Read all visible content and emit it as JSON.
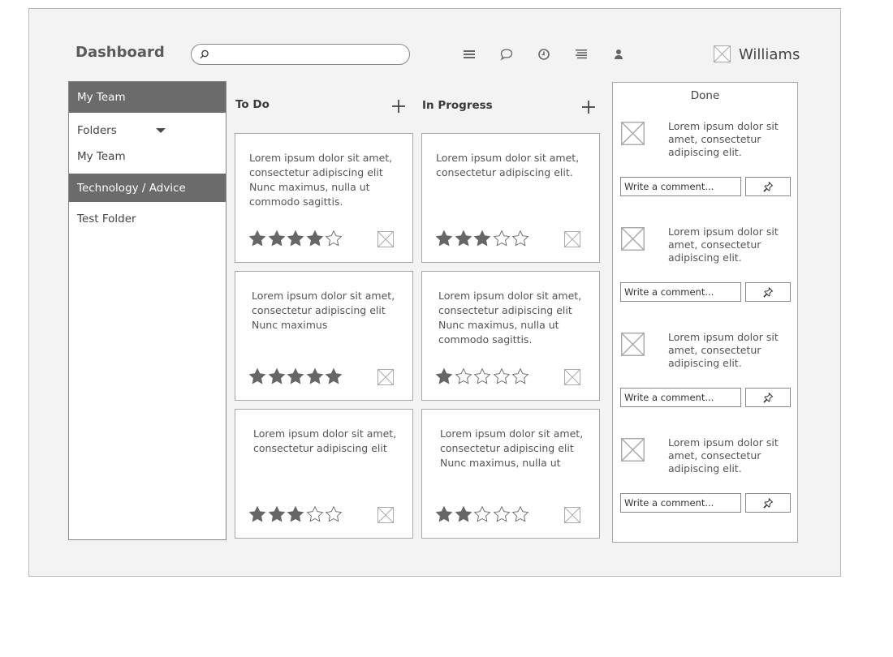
{
  "header": {
    "title": "Dashboard",
    "search_placeholder": "",
    "user_name": "Williams"
  },
  "toolbar_icons": [
    "menu-icon",
    "chat-icon",
    "clock-icon",
    "list-icon",
    "user-icon"
  ],
  "sidebar": {
    "items": [
      {
        "label": "My Team",
        "active": true
      },
      {
        "label": "Folders",
        "expandable": true
      },
      {
        "label": "My Team",
        "active": false
      },
      {
        "label": "Technology / Advice",
        "active": true
      },
      {
        "label": "Test Folder",
        "active": false
      }
    ]
  },
  "columns": [
    {
      "title": "To Do",
      "cards": [
        {
          "lines": [
            "Lorem ipsum dolor sit amet,",
            "consectetur adipiscing elit",
            "Nunc maximus, nulla ut",
            "commodo sagittis."
          ],
          "rating": 4
        },
        {
          "lines": [
            "Lorem ipsum dolor sit amet,",
            "consectetur adipiscing elit",
            "Nunc maximus"
          ],
          "rating": 5
        },
        {
          "lines": [
            "Lorem ipsum dolor sit amet,",
            "consectetur adipiscing elit"
          ],
          "rating": 3
        }
      ]
    },
    {
      "title": "In Progress",
      "cards": [
        {
          "lines": [
            "Lorem ipsum dolor sit amet,",
            "consectetur adipiscing elit."
          ],
          "rating": 3
        },
        {
          "lines": [
            "Lorem ipsum dolor sit amet,",
            "consectetur adipiscing elit",
            "Nunc maximus, nulla ut",
            "commodo sagittis."
          ],
          "rating": 1
        },
        {
          "lines": [
            "Lorem ipsum dolor sit amet,",
            "consectetur adipiscing elit",
            "Nunc maximus, nulla ut"
          ],
          "rating": 2
        }
      ]
    }
  ],
  "done": {
    "title": "Done",
    "items": [
      {
        "lines": [
          "Lorem ipsum dolor sit",
          "amet, consectetur",
          "adipiscing elit."
        ],
        "comment": "Write a comment..."
      },
      {
        "lines": [
          "Lorem ipsum dolor sit",
          "amet, consectetur",
          "adipiscing elit."
        ],
        "comment": "Write a comment..."
      },
      {
        "lines": [
          "Lorem ipsum dolor sit",
          "amet, consectetur",
          "adipiscing elit."
        ],
        "comment": "Write a comment..."
      },
      {
        "lines": [
          "Lorem ipsum dolor sit",
          "amet, consectetur",
          "adipiscing elit."
        ],
        "comment": "Write a comment..."
      }
    ]
  },
  "colors": {
    "frame_bg": "#f3f3f3",
    "active_bg": "#6b6b6b",
    "star_filled": "#666666"
  }
}
